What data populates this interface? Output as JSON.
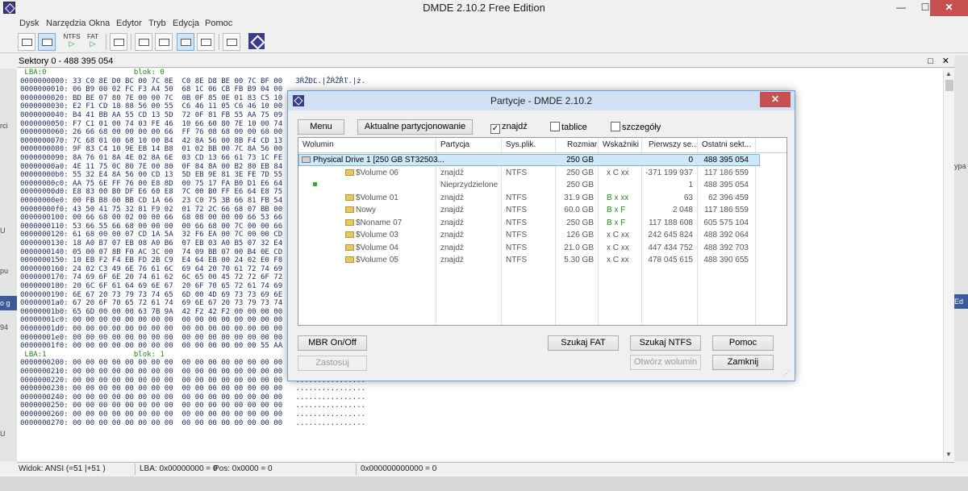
{
  "window": {
    "title": "DMDE 2.10.2 Free Edition",
    "controls": {
      "minimize": "—",
      "maximize": "☐",
      "close": "✕"
    }
  },
  "menu": [
    "Dysk",
    "Narzędzia",
    "Okna",
    "Edytor",
    "Tryb",
    "Edycja",
    "Pomoc"
  ],
  "toolbar": {
    "ntfs_label": "NTFS",
    "fat_label": "FAT",
    "play": "▷"
  },
  "hex_view": {
    "header": "Sektory 0 - 488 395 054",
    "header_controls": "□ ✕",
    "lines": [
      {
        "text": " LBA:0                    blok: 0",
        "kind": "hdr"
      },
      {
        "text": "0000000000: 33 C0 8E D0 BC 00 7C 8E  C0 8E D8 BE 00 7C BF 00   3ŔŽĐĽ.|ŽŔŽŘľ.|ż.",
        "kind": "data"
      },
      {
        "text": "0000000010: 06 B9 00 02 FC F3 A4 50  68 1C 06 CB FB B9 04 00",
        "kind": "data"
      },
      {
        "text": "0000000020: BD BE 07 80 7E 00 00 7C  0B 0F 85 0E 01 83 C5 10",
        "kind": "data"
      },
      {
        "text": "0000000030: E2 F1 CD 18 88 56 00 55  C6 46 11 05 C6 46 10 00",
        "kind": "data"
      },
      {
        "text": "0000000040: B4 41 BB AA 55 CD 13 5D  72 0F 81 FB 55 AA 75 09",
        "kind": "data"
      },
      {
        "text": "0000000050: F7 C1 01 00 74 03 FE 46  10 66 60 80 7E 10 00 74",
        "kind": "data"
      },
      {
        "text": "0000000060: 26 66 68 00 00 00 00 66  FF 76 08 68 00 00 68 00",
        "kind": "data"
      },
      {
        "text": "0000000070: 7C 68 01 00 68 10 00 B4  42 8A 56 00 8B F4 CD 13",
        "kind": "data"
      },
      {
        "text": "0000000080: 9F 83 C4 10 9E EB 14 B8  01 02 BB 00 7C 8A 56 00",
        "kind": "data"
      },
      {
        "text": "0000000090: 8A 76 01 8A 4E 02 8A 6E  03 CD 13 66 61 73 1C FE",
        "kind": "data"
      },
      {
        "text": "00000000a0: 4E 11 75 0C 80 7E 00 80  0F 84 8A 00 B2 80 EB 84",
        "kind": "data"
      },
      {
        "text": "00000000b0: 55 32 E4 8A 56 00 CD 13  5D EB 9E 81 3E FE 7D 55",
        "kind": "data"
      },
      {
        "text": "00000000c0: AA 75 6E FF 76 00 E8 8D  00 75 17 FA B0 D1 E6 64",
        "kind": "data"
      },
      {
        "text": "00000000d0: E8 83 00 B0 DF E6 60 E8  7C 00 B0 FF E6 64 E8 75",
        "kind": "data"
      },
      {
        "text": "00000000e0: 00 FB B8 00 BB CD 1A 66  23 C0 75 3B 66 81 FB 54",
        "kind": "data"
      },
      {
        "text": "00000000f0: 43 50 41 75 32 81 F9 02  01 72 2C 66 68 07 BB 00",
        "kind": "data"
      },
      {
        "text": "0000000100: 00 66 68 00 02 00 00 66  68 08 00 00 00 66 53 66",
        "kind": "data"
      },
      {
        "text": "0000000110: 53 66 55 66 68 00 00 00  00 66 68 00 7C 00 00 66",
        "kind": "data"
      },
      {
        "text": "0000000120: 61 68 00 00 07 CD 1A 5A  32 F6 EA 00 7C 00 00 CD",
        "kind": "data"
      },
      {
        "text": "0000000130: 18 A0 B7 07 EB 08 A0 B6  07 EB 03 A0 B5 07 32 E4",
        "kind": "data"
      },
      {
        "text": "0000000140: 05 00 07 8B F0 AC 3C 00  74 09 BB 07 00 B4 0E CD",
        "kind": "data"
      },
      {
        "text": "0000000150: 10 EB F2 F4 EB FD 2B C9  E4 64 EB 00 24 02 E0 F8",
        "kind": "data"
      },
      {
        "text": "0000000160: 24 02 C3 49 6E 76 61 6C  69 64 20 70 61 72 74 69",
        "kind": "data"
      },
      {
        "text": "0000000170: 74 69 6F 6E 20 74 61 62  6C 65 00 45 72 72 6F 72",
        "kind": "data"
      },
      {
        "text": "0000000180: 20 6C 6F 61 64 69 6E 67  20 6F 70 65 72 61 74 69",
        "kind": "data"
      },
      {
        "text": "0000000190: 6E 67 20 73 79 73 74 65  6D 00 4D 69 73 73 69 6E",
        "kind": "data"
      },
      {
        "text": "00000001a0: 67 20 6F 70 65 72 61 74  69 6E 67 20 73 79 73 74",
        "kind": "data"
      },
      {
        "text": "00000001b0: 65 6D 00 00 00 63 7B 9A  42 F2 42 F2 00 00 00 00",
        "kind": "data"
      },
      {
        "text": "00000001c0: 00 00 00 00 00 00 00 00  00 00 00 00 00 00 00 00",
        "kind": "data"
      },
      {
        "text": "00000001d0: 00 00 00 00 00 00 00 00  00 00 00 00 00 00 00 00",
        "kind": "data"
      },
      {
        "text": "00000001e0: 00 00 00 00 00 00 00 00  00 00 00 00 00 00 00 00",
        "kind": "data"
      },
      {
        "text": "00000001f0: 00 00 00 00 00 00 00 00  00 00 00 00 00 00 55 AA",
        "kind": "data"
      },
      {
        "text": " LBA:1                    blok: 1",
        "kind": "hdr"
      },
      {
        "text": "0000000200: 00 00 00 00 00 00 00 00  00 00 00 00 00 00 00 00   ................",
        "kind": "data"
      },
      {
        "text": "0000000210: 00 00 00 00 00 00 00 00  00 00 00 00 00 00 00 00   ................",
        "kind": "data"
      },
      {
        "text": "0000000220: 00 00 00 00 00 00 00 00  00 00 00 00 00 00 00 00   ................",
        "kind": "data"
      },
      {
        "text": "0000000230: 00 00 00 00 00 00 00 00  00 00 00 00 00 00 00 00   ................",
        "kind": "data"
      },
      {
        "text": "0000000240: 00 00 00 00 00 00 00 00  00 00 00 00 00 00 00 00   ................",
        "kind": "data"
      },
      {
        "text": "0000000250: 00 00 00 00 00 00 00 00  00 00 00 00 00 00 00 00   ................",
        "kind": "data"
      },
      {
        "text": "0000000260: 00 00 00 00 00 00 00 00  00 00 00 00 00 00 00 00   ................",
        "kind": "data"
      },
      {
        "text": "0000000270: 00 00 00 00 00 00 00 00  00 00 00 00 00 00 00 00   ................",
        "kind": "data"
      }
    ]
  },
  "status_bar": {
    "mode": "Widok: ANSI (=51 |+51 )",
    "lba": "LBA: 0x00000000 = 0",
    "pos": "Pos: 0x0000 = 0",
    "offset": "0x000000000000 = 0"
  },
  "dialog": {
    "title": "Partycje - DMDE 2.10.2",
    "close": "✕",
    "menu_button": "Menu",
    "current_partitioning_button": "Aktualne partycjonowanie",
    "checkboxes": {
      "found": {
        "label": "znajdź",
        "checked": true,
        "mark": "✓"
      },
      "tables": {
        "label": "tablice",
        "checked": false,
        "mark": ""
      },
      "details": {
        "label": "szczegóły",
        "checked": false,
        "mark": ""
      }
    },
    "columns": [
      "Wolumin",
      "Partycja",
      "Sys.plik.",
      "Rozmiar",
      "Wskaźniki",
      "Pierwszy se...",
      "Ostatni sekt..."
    ],
    "rows": [
      {
        "volume": "Physical Drive 1 [250 GB ST32503...",
        "partition": "",
        "fs": "",
        "size": "250 GB",
        "ind": "",
        "first": "0",
        "last": "488 395 054",
        "kind": "disk",
        "selected": true
      },
      {
        "volume": "$Volume 06",
        "partition": "znajdź",
        "fs": "NTFS",
        "size": "250 GB",
        "ind": "x C xx",
        "first": "-371 199 937",
        "last": "117 186 559",
        "kind": "folder",
        "selected": false
      },
      {
        "volume": "",
        "partition": "Nieprzydzielone",
        "fs": "",
        "size": "250 GB",
        "ind": "",
        "first": "1",
        "last": "488 395 054",
        "kind": "free",
        "selected": false
      },
      {
        "volume": "$Volume 01",
        "partition": "znajdź",
        "fs": "NTFS",
        "size": "31.9 GB",
        "ind": "B x xx",
        "first": "63",
        "last": "62 396 459",
        "kind": "folder",
        "selected": false
      },
      {
        "volume": "Nowy",
        "partition": "znajdź",
        "fs": "NTFS",
        "size": "60.0 GB",
        "ind": "B x F",
        "first": "2 048",
        "last": "117 186 559",
        "kind": "folder",
        "selected": false
      },
      {
        "volume": "$Noname 07",
        "partition": "znajdź",
        "fs": "NTFS",
        "size": "250 GB",
        "ind": "B x F",
        "first": "117 188 608",
        "last": "605 575 104",
        "kind": "folder",
        "selected": false
      },
      {
        "volume": "$Volume 03",
        "partition": "znajdź",
        "fs": "NTFS",
        "size": "126 GB",
        "ind": "x C xx",
        "first": "242 645 824",
        "last": "488 392 064",
        "kind": "folder",
        "selected": false
      },
      {
        "volume": "$Volume 04",
        "partition": "znajdź",
        "fs": "NTFS",
        "size": "21.0 GB",
        "ind": "x C xx",
        "first": "447 434 752",
        "last": "488 392 703",
        "kind": "folder",
        "selected": false
      },
      {
        "volume": "$Volume 05",
        "partition": "znajdź",
        "fs": "NTFS",
        "size": "5.30 GB",
        "ind": "x C xx",
        "first": "478 045 615",
        "last": "488 390 655",
        "kind": "folder",
        "selected": false
      }
    ],
    "buttons": {
      "mbr": "MBR On/Off",
      "apply": "Zastosuj",
      "search_fat": "Szukaj FAT",
      "search_ntfs": "Szukaj NTFS",
      "help": "Pomoc",
      "open_volume": "Otwórz wolumin",
      "close": "Zamknij"
    }
  },
  "side_fragments": {
    "left": [
      "rci",
      "U",
      "pu",
      "o g",
      "94",
      "U"
    ],
    "right": [
      "ypa",
      "Ed"
    ]
  },
  "colors": {
    "accent": "#3c3a8c",
    "close_red": "#c75050",
    "selection": "#cde8f8",
    "hex_text": "#1a2b5a",
    "hex_header": "#1a8a1a",
    "indicator_green": "#1e8a1e"
  }
}
